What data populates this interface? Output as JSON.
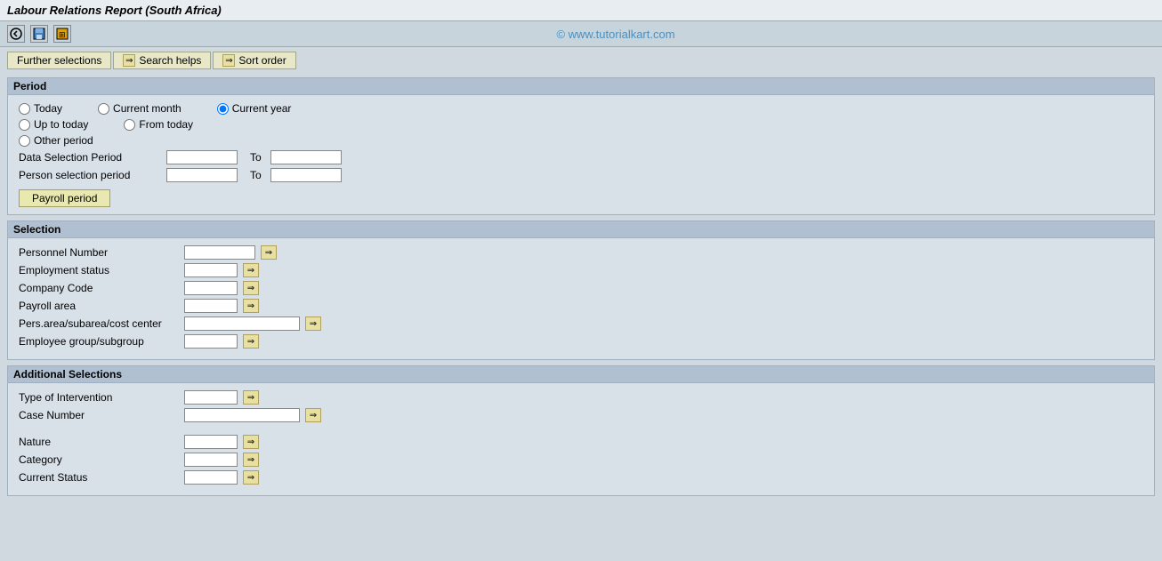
{
  "title": "Labour Relations Report (South Africa)",
  "watermark": "© www.tutorialkart.com",
  "tabs": [
    {
      "id": "further-selections",
      "label": "Further selections",
      "has_arrow": true
    },
    {
      "id": "search-helps",
      "label": "Search helps",
      "has_arrow": true
    },
    {
      "id": "sort-order",
      "label": "Sort order",
      "has_arrow": false
    }
  ],
  "sections": {
    "period": {
      "header": "Period",
      "radio_options": [
        {
          "id": "today",
          "label": "Today",
          "name": "period",
          "checked": false
        },
        {
          "id": "current_month",
          "label": "Current month",
          "name": "period",
          "checked": false
        },
        {
          "id": "current_year",
          "label": "Current year",
          "name": "period",
          "checked": true
        },
        {
          "id": "up_to_today",
          "label": "Up to today",
          "name": "period",
          "checked": false
        },
        {
          "id": "from_today",
          "label": "From today",
          "name": "period",
          "checked": false
        },
        {
          "id": "other_period",
          "label": "Other period",
          "name": "period",
          "checked": false
        }
      ],
      "fields": [
        {
          "id": "data_selection_period",
          "label": "Data Selection Period",
          "size": "md",
          "to": true
        },
        {
          "id": "person_selection_period",
          "label": "Person selection period",
          "size": "md",
          "to": true
        }
      ],
      "payroll_btn": "Payroll period"
    },
    "selection": {
      "header": "Selection",
      "fields": [
        {
          "id": "personnel_number",
          "label": "Personnel Number",
          "size": "md",
          "arrow": true
        },
        {
          "id": "employment_status",
          "label": "Employment status",
          "size": "sm",
          "arrow": true
        },
        {
          "id": "company_code",
          "label": "Company Code",
          "size": "sm",
          "arrow": true
        },
        {
          "id": "payroll_area",
          "label": "Payroll area",
          "size": "sm",
          "arrow": true
        },
        {
          "id": "pers_area",
          "label": "Pers.area/subarea/cost center",
          "size": "lg",
          "arrow": true
        },
        {
          "id": "employee_group",
          "label": "Employee group/subgroup",
          "size": "sm",
          "arrow": true
        }
      ]
    },
    "additional_selections": {
      "header": "Additional Selections",
      "fields_top": [
        {
          "id": "type_of_intervention",
          "label": "Type of Intervention",
          "size": "sm",
          "arrow": true
        },
        {
          "id": "case_number",
          "label": "Case Number",
          "size": "lg",
          "arrow": true
        }
      ],
      "fields_bottom": [
        {
          "id": "nature",
          "label": "Nature",
          "size": "sm",
          "arrow": true
        },
        {
          "id": "category",
          "label": "Category",
          "size": "sm",
          "arrow": true
        },
        {
          "id": "current_status",
          "label": "Current Status",
          "size": "sm",
          "arrow": true
        }
      ]
    }
  },
  "icons": {
    "nav_back": "←",
    "save": "💾",
    "shortcut": "⊞",
    "arrow_right": "⇒"
  }
}
